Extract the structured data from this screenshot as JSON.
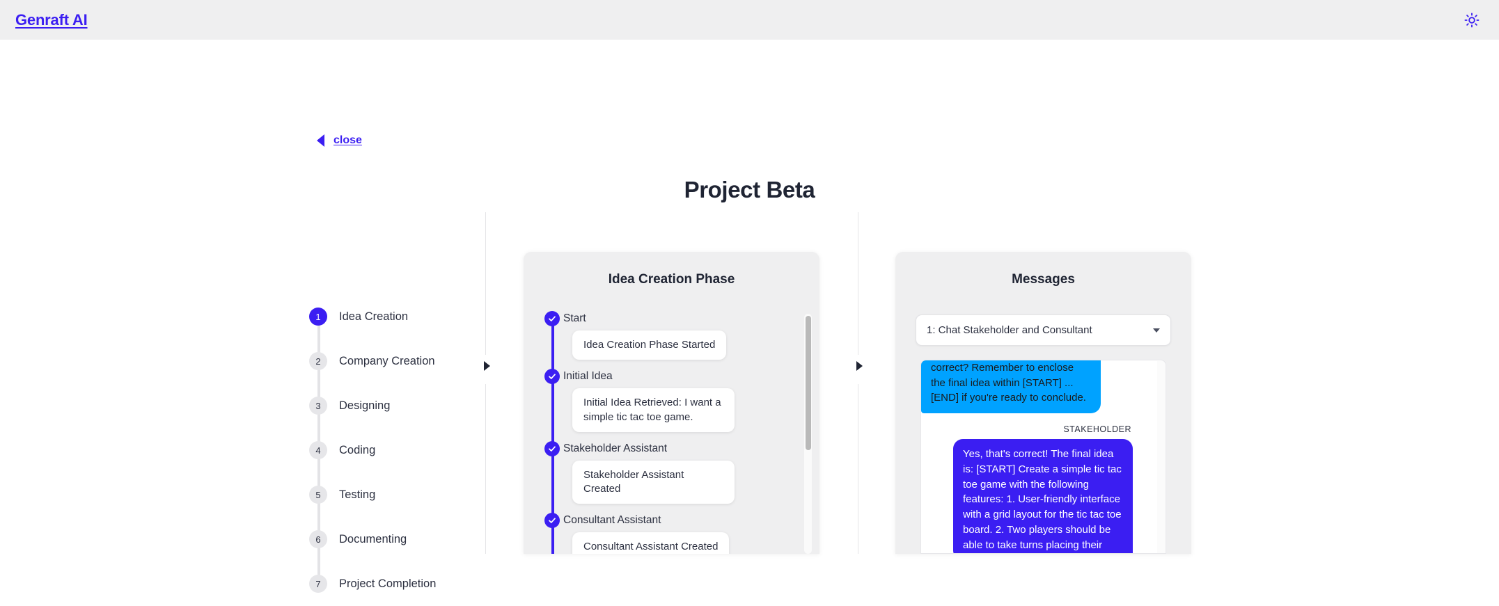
{
  "header": {
    "brand": "Genraft AI",
    "theme_toggle_icon": "sun-icon"
  },
  "nav": {
    "close_label": "close",
    "back_icon": "triangle-left-icon"
  },
  "page_title": "Project Beta",
  "stepper": {
    "active_index": 1,
    "items": [
      {
        "number": "1",
        "label": "Idea Creation"
      },
      {
        "number": "2",
        "label": "Company Creation"
      },
      {
        "number": "3",
        "label": "Designing"
      },
      {
        "number": "4",
        "label": "Coding"
      },
      {
        "number": "5",
        "label": "Testing"
      },
      {
        "number": "6",
        "label": "Documenting"
      },
      {
        "number": "7",
        "label": "Project Completion"
      }
    ]
  },
  "dividers": {
    "expand_icon": "triangle-right-icon"
  },
  "idea_panel": {
    "title": "Idea Creation Phase",
    "timeline": [
      {
        "heading": "Start",
        "card": "Idea Creation Phase Started",
        "status_icon": "check-circle-icon"
      },
      {
        "heading": "Initial Idea",
        "card": "Initial Idea Retrieved: I want a simple tic tac toe game.",
        "status_icon": "check-circle-icon"
      },
      {
        "heading": "Stakeholder Assistant",
        "card": "Stakeholder Assistant Created",
        "status_icon": "check-circle-icon"
      },
      {
        "heading": "Consultant Assistant",
        "card": "Consultant Assistant Created",
        "status_icon": "check-circle-icon"
      }
    ]
  },
  "messages_panel": {
    "title": "Messages",
    "chat_select": {
      "value": "1: Chat Stakeholder and Consultant",
      "caret_icon": "chevron-down-icon"
    },
    "messages": [
      {
        "side": "left",
        "speaker": "",
        "color": "cyan",
        "text": "to start a new game. Is that correct? Remember to enclose the final idea within [START] ... [END] if you're ready to conclude."
      },
      {
        "side": "right",
        "speaker": "STAKEHOLDER",
        "color": "violet",
        "text": "Yes, that's correct! The final idea is: [START] Create a simple tic tac toe game with the following features: 1. User-friendly interface with a grid layout for the tic tac toe board. 2. Two players should be able to take turns placing their"
      }
    ]
  },
  "colors": {
    "accent": "#3b1ef2",
    "cyan_bubble": "#00a2ff",
    "panel_bg": "#efeff0",
    "text_dark": "#2c3040"
  }
}
